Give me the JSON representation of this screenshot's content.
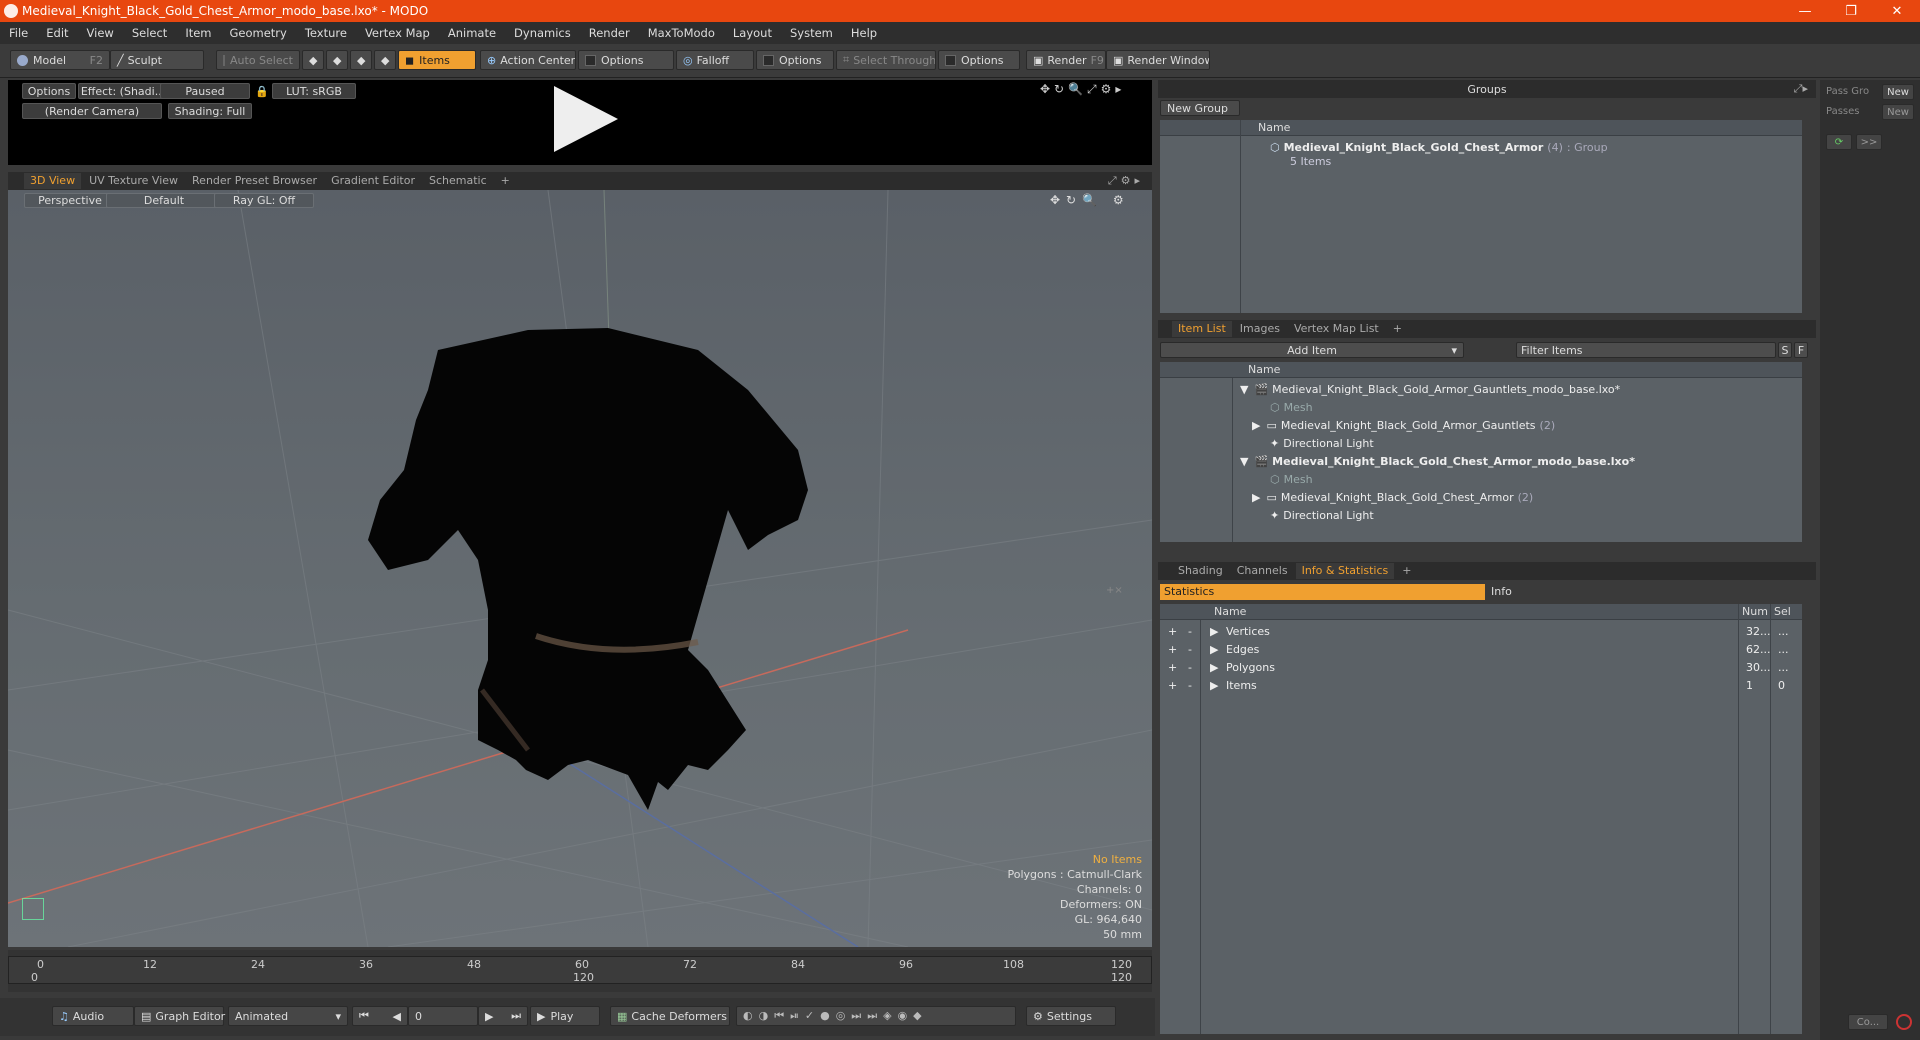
{
  "window": {
    "title": "Medieval_Knight_Black_Gold_Chest_Armor_modo_base.lxo* - MODO",
    "min": "—",
    "max": "❐",
    "close": "✕"
  },
  "menu": [
    "File",
    "Edit",
    "View",
    "Select",
    "Item",
    "Geometry",
    "Texture",
    "Vertex Map",
    "Animate",
    "Dynamics",
    "Render",
    "MaxToModo",
    "Layout",
    "System",
    "Help"
  ],
  "toolbar": {
    "model": "Model",
    "model_key": "F2",
    "sculpt": "Sculpt",
    "auto_select": "Auto Select",
    "items": "Items",
    "action_center": "Action Center",
    "options1": "Options",
    "falloff": "Falloff",
    "options2": "Options",
    "select_through": "Select Through",
    "options3": "Options",
    "render": "Render",
    "render_key": "F9",
    "render_window": "Render Window"
  },
  "preview": {
    "options": "Options",
    "effect": "Effect: (Shadi...",
    "paused": "Paused",
    "lut": "LUT: sRGB",
    "camera": "(Render Camera)",
    "shading": "Shading: Full"
  },
  "viewtabs": [
    "3D View",
    "UV Texture View",
    "Render Preset Browser",
    "Gradient Editor",
    "Schematic",
    "+"
  ],
  "viewport": {
    "perspective": "Perspective",
    "default": "Default",
    "raygl": "Ray GL: Off",
    "stats": {
      "noitems": "No Items",
      "polygons": "Polygons : Catmull-Clark",
      "channels": "Channels: 0",
      "deformers": "Deformers: ON",
      "gl": "GL: 964,640",
      "lens": "50 mm"
    }
  },
  "timeline": {
    "ticks": [
      "0",
      "12",
      "24",
      "36",
      "48",
      "60",
      "72",
      "84",
      "96",
      "108",
      "120"
    ],
    "sub_start": "0",
    "sub_mid": "120",
    "sub_end": "120"
  },
  "bottombar": {
    "audio": "Audio",
    "graph_editor": "Graph Editor",
    "animated": "Animated",
    "frame": "0",
    "play": "Play",
    "cache": "Cache Deformers",
    "settings": "Settings"
  },
  "groups": {
    "header": "Groups",
    "new_group": "New Group",
    "col_name": "Name",
    "group_name": "Medieval_Knight_Black_Gold_Chest_Armor",
    "group_count": "(4)",
    "group_type": ": Group",
    "group_items": "5 Items"
  },
  "passes": {
    "pass_groups": "Pass Gro",
    "new1": "New",
    "passes": "Passes",
    "new2": "New",
    "arrows": ">>"
  },
  "itemlist": {
    "tabs": [
      "Item List",
      "Images",
      "Vertex Map List",
      "+"
    ],
    "add_item": "Add Item",
    "filter": "Filter Items",
    "s": "S",
    "f": "F",
    "col_name": "Name",
    "rows": [
      {
        "label": "Medieval_Knight_Black_Gold_Armor_Gauntlets_modo_base.lxo*",
        "count": ""
      },
      {
        "label": "Mesh",
        "count": ""
      },
      {
        "label": "Medieval_Knight_Black_Gold_Armor_Gauntlets",
        "count": "(2)"
      },
      {
        "label": "Directional Light",
        "count": ""
      },
      {
        "label": "Medieval_Knight_Black_Gold_Chest_Armor_modo_base.lxo*",
        "count": ""
      },
      {
        "label": "Mesh",
        "count": ""
      },
      {
        "label": "Medieval_Knight_Black_Gold_Chest_Armor",
        "count": "(2)"
      },
      {
        "label": "Directional Light",
        "count": ""
      }
    ]
  },
  "stats": {
    "tabs": [
      "Shading",
      "Channels",
      "Info & Statistics",
      "+"
    ],
    "sub_tab_statistics": "Statistics",
    "sub_tab_info": "Info",
    "col_name": "Name",
    "col_num": "Num",
    "col_sel": "Sel",
    "rows": [
      {
        "name": "Vertices",
        "num": "32...",
        "sel": "..."
      },
      {
        "name": "Edges",
        "num": "62...",
        "sel": "..."
      },
      {
        "name": "Polygons",
        "num": "30...",
        "sel": "..."
      },
      {
        "name": "Items",
        "num": "1",
        "sel": "0"
      }
    ]
  },
  "farright": {
    "co": "Co..."
  },
  "colors": {
    "title_bar": "#e8470f",
    "accent": "#f0a030",
    "viewport": "#666d72"
  }
}
